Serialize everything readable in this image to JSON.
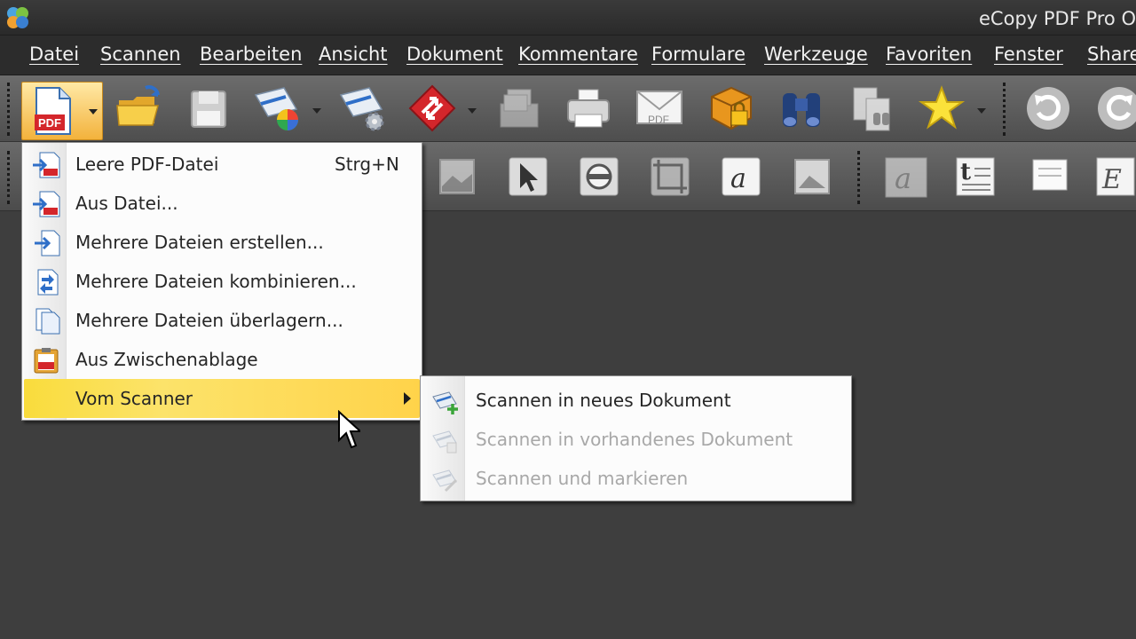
{
  "window": {
    "title": "eCopy PDF Pro O"
  },
  "menubar": {
    "items": [
      {
        "label": "Datei"
      },
      {
        "label": "Scannen"
      },
      {
        "label": "Bearbeiten"
      },
      {
        "label": "Ansicht"
      },
      {
        "label": "Dokument"
      },
      {
        "label": "Kommentare"
      },
      {
        "label": "Formulare"
      },
      {
        "label": "Werkzeuge"
      },
      {
        "label": "Favoriten"
      },
      {
        "label": "Fenster"
      },
      {
        "label": "Share"
      }
    ]
  },
  "toolbar1": {
    "icons": [
      "new-pdf-icon",
      "open-folder-icon",
      "save-icon",
      "scan-color-icon",
      "scan-settings-icon",
      "convert-icon",
      "print-batch-icon",
      "print-icon",
      "email-pdf-icon",
      "security-package-icon",
      "find-binoculars-icon",
      "compare-icon",
      "favorites-star-icon",
      "undo-icon",
      "redo-icon"
    ]
  },
  "toolbar2": {
    "icons": [
      "image-tool-icon",
      "select-arrow-icon",
      "snapshot-icon",
      "crop-icon",
      "text-edit-icon",
      "image-edit-icon",
      "signature-icon",
      "typewriter-icon",
      "note-icon",
      "formula-icon"
    ]
  },
  "new_menu": {
    "items": [
      {
        "label": "Leere PDF-Datei",
        "shortcut": "Strg+N",
        "icon": "blank-pdf-icon"
      },
      {
        "label": "Aus Datei...",
        "icon": "from-file-icon"
      },
      {
        "label": "Mehrere Dateien erstellen...",
        "icon": "create-multiple-icon"
      },
      {
        "label": "Mehrere Dateien kombinieren...",
        "icon": "combine-files-icon"
      },
      {
        "label": "Mehrere Dateien überlagern...",
        "icon": "overlay-files-icon"
      },
      {
        "label": "Aus Zwischenablage",
        "icon": "clipboard-pdf-icon"
      },
      {
        "label": "Vom Scanner",
        "icon": "",
        "highlighted": true,
        "has_submenu": true
      }
    ]
  },
  "scanner_submenu": {
    "items": [
      {
        "label": "Scannen in neues Dokument",
        "enabled": true,
        "icon": "scan-new-doc-icon"
      },
      {
        "label": "Scannen in vorhandenes Dokument",
        "enabled": false,
        "icon": "scan-existing-doc-icon"
      },
      {
        "label": "Scannen und markieren",
        "enabled": false,
        "icon": "scan-markup-icon"
      }
    ]
  },
  "colors": {
    "highlight": "#f9dc3c",
    "pdf_red": "#d4262b",
    "accent_blue": "#2f6fc8"
  }
}
